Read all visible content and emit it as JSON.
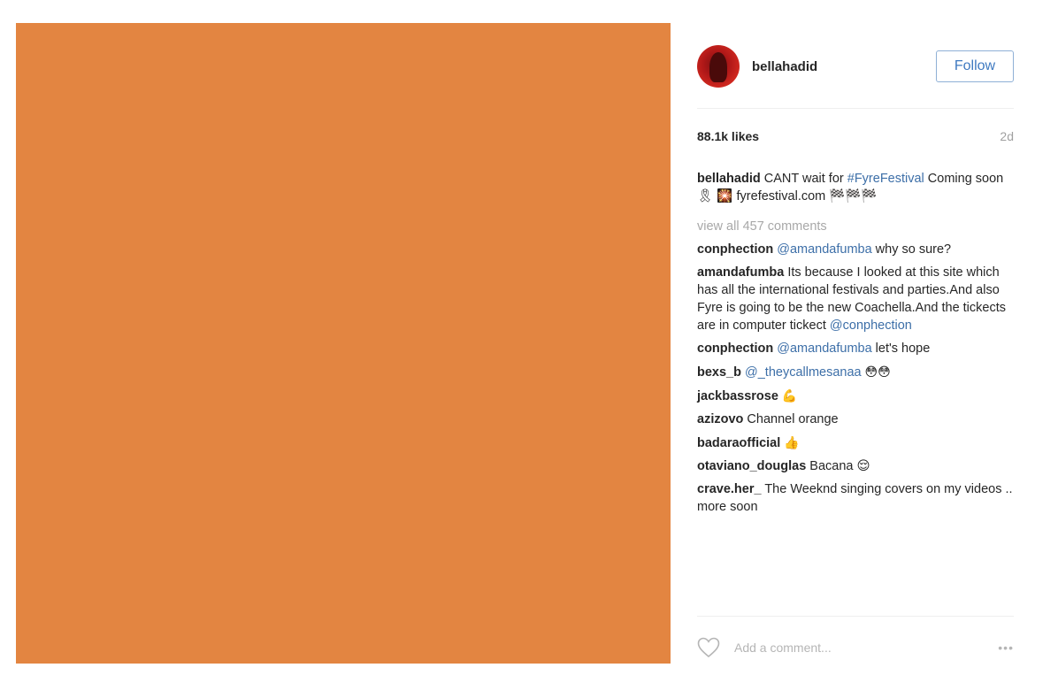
{
  "image": {
    "background_color": "#E38541"
  },
  "header": {
    "username": "bellahadid",
    "follow_label": "Follow"
  },
  "stats": {
    "likes": "88.1k likes",
    "time": "2d"
  },
  "caption": {
    "username": "bellahadid",
    "text_1": " CANT wait for ",
    "hashtag": "#FyreFestival",
    "text_2": " Coming soon 🎗 🎇 fyrefestival.com 🏁🏁🏁"
  },
  "view_all_label": "view all 457 comments",
  "comments": [
    {
      "username": "conphection",
      "mention": "@amandafumba",
      "text": " why so sure?"
    },
    {
      "username": "amandafumba",
      "text": " Its because I looked at this site which has all the international festivals and parties.And also Fyre is going to be the new Coachella.And the tickects are in computer tickect ",
      "mention": "@conphection"
    },
    {
      "username": "conphection",
      "mention": "@amandafumba",
      "text": " let's hope"
    },
    {
      "username": "bexs_b",
      "mention": "@_theycallmesanaa",
      "text": " 😳😳"
    },
    {
      "username": "jackbassrose",
      "text": " 💪"
    },
    {
      "username": "azizovo",
      "text": " Channel orange"
    },
    {
      "username": "badaraofficial",
      "text": " 👍"
    },
    {
      "username": "otaviano_douglas",
      "text": " Bacana 😌"
    },
    {
      "username": "crave.her_",
      "text": " The Weeknd singing covers on my videos .. more soon"
    }
  ],
  "add_comment": {
    "placeholder": "Add a comment...",
    "more_label": "•••"
  },
  "colors": {
    "link": "#3D6FA8",
    "follow_border": "#8FB0D6"
  }
}
